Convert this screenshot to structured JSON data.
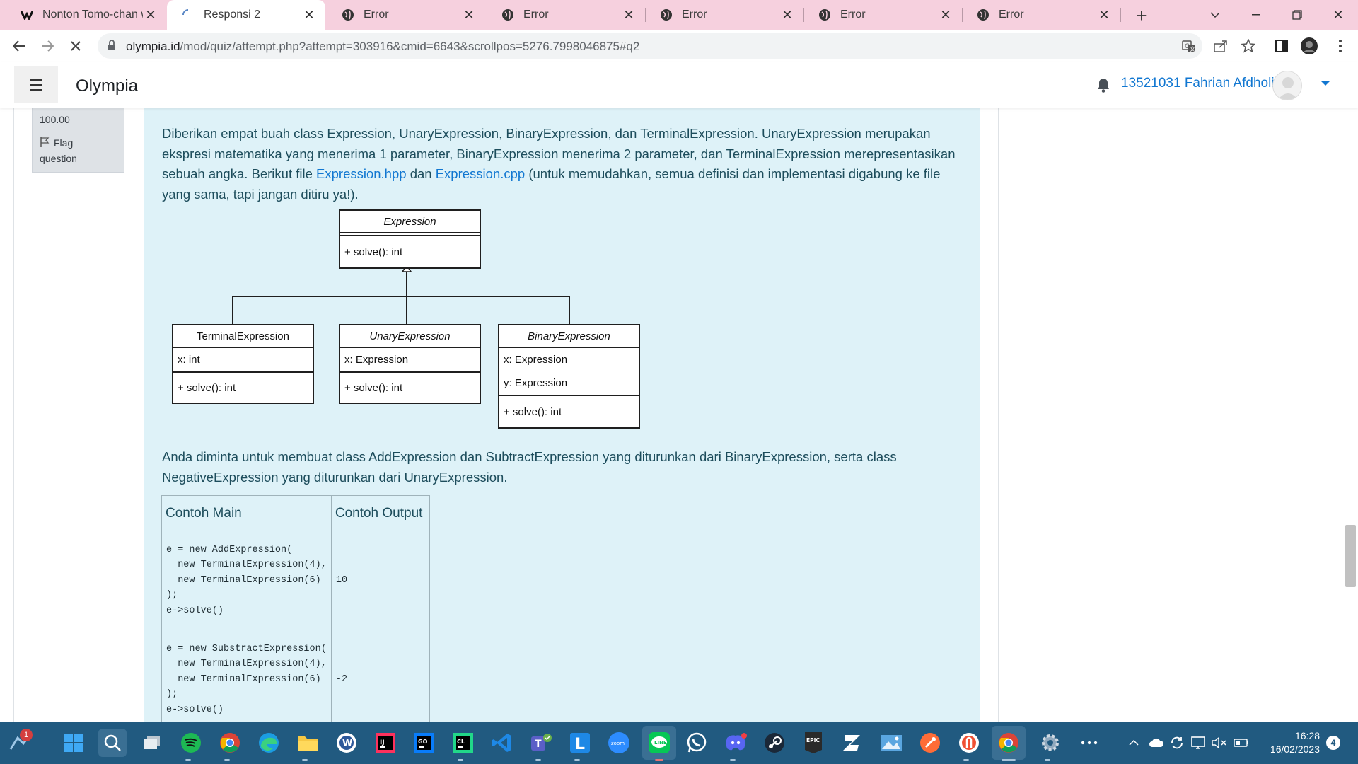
{
  "browser": {
    "tabs": [
      {
        "title": "Nonton Tomo-chan w",
        "icon": "anime-site-icon"
      },
      {
        "title": "Responsi 2",
        "icon": "loading-spinner-icon",
        "active": true
      },
      {
        "title": "Error",
        "icon": "globe-icon"
      },
      {
        "title": "Error",
        "icon": "globe-icon"
      },
      {
        "title": "Error",
        "icon": "globe-icon"
      },
      {
        "title": "Error",
        "icon": "globe-icon"
      },
      {
        "title": "Error",
        "icon": "globe-icon"
      }
    ],
    "url_host": "olympia.id",
    "url_path": "/mod/quiz/attempt.php?attempt=303916&cmid=6643&scrollpos=5276.7998046875#q2"
  },
  "navbar": {
    "site_name": "Olympia",
    "user_name": "13521031 Fahrian Afdholi"
  },
  "question_info": {
    "mark": "100.00",
    "flag_label": "Flag question"
  },
  "question": {
    "intro_before_hpp": "Diberikan empat buah class Expression, UnaryExpression, BinaryExpression, dan TerminalExpression. UnaryExpression merupakan ekspresi matematika yang menerima 1 parameter, BinaryExpression menerima 2 parameter, dan TerminalExpression merepresentasikan sebuah angka. Berikut file ",
    "link_hpp": "Expression.hpp",
    "intro_between": " dan ",
    "link_cpp": "Expression.cpp",
    "intro_after": " (untuk memudahkan, semua definisi dan implementasi digabung ke file yang sama, tapi jangan ditiru ya!).",
    "task": "Anda diminta untuk membuat class AddExpression dan SubtractExpression yang diturunkan dari BinaryExpression, serta class NegativeExpression yang diturunkan dari UnaryExpression."
  },
  "uml": {
    "expression": {
      "name": "Expression",
      "method": "+ solve(): int"
    },
    "terminal": {
      "name": "TerminalExpression",
      "attr1": "x: int",
      "method": "+ solve(): int"
    },
    "unary": {
      "name": "UnaryExpression",
      "attr1": "x: Expression",
      "method": "+ solve(): int"
    },
    "binary": {
      "name": "BinaryExpression",
      "attr1": "x: Expression",
      "attr2": "y: Expression",
      "method": "+ solve(): int"
    }
  },
  "example_table": {
    "headers": [
      "Contoh Main",
      "Contoh Output"
    ],
    "rows": [
      {
        "code": "e = new AddExpression(\n  new TerminalExpression(4),\n  new TerminalExpression(6)\n);\ne->solve()",
        "output": "10"
      },
      {
        "code": "e = new SubstractExpression(\n  new TerminalExpression(4),\n  new TerminalExpression(6)\n);\ne->solve()",
        "output": "-2"
      }
    ]
  },
  "taskbar": {
    "weather_badge": "1",
    "time": "16:28",
    "date": "16/02/2023",
    "notification_count": "4",
    "apps": [
      "windows-start-icon",
      "search-icon",
      "task-view-icon",
      "spotify-icon",
      "chrome-icon",
      "edge-icon",
      "file-explorer-icon",
      "word-icon",
      "intellij-icon",
      "goland-icon",
      "clion-icon",
      "vscode-icon",
      "teams-icon",
      "line-l-icon",
      "zoom-icon",
      "line-chat-icon",
      "whatsapp-icon",
      "discord-icon",
      "steam-icon",
      "epic-games-icon",
      "z-app-icon",
      "image-viewer-icon",
      "postman-icon",
      "git-icon",
      "chrome-active-icon",
      "settings-icon",
      "more-icon"
    ]
  },
  "colors": {
    "tab_strip": "#f6d0de",
    "link": "#1177d1",
    "question_bg": "#def2f8",
    "taskbar": "#215a80"
  }
}
